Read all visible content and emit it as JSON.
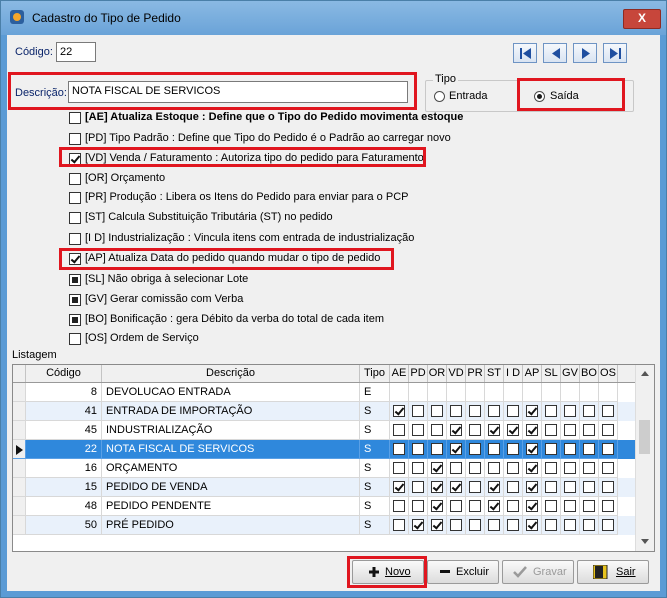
{
  "window": {
    "title": "Cadastro do Tipo de Pedido",
    "close_label": "X"
  },
  "codigo": {
    "label": "Código:",
    "value": "22"
  },
  "nav": {
    "icons": [
      "first-record-icon",
      "prev-record-icon",
      "next-record-icon",
      "last-record-icon"
    ]
  },
  "descricao": {
    "label": "Descrição:",
    "value": "NOTA FISCAL DE SERVICOS"
  },
  "tipo": {
    "group_label": "Tipo",
    "entrada": "Entrada",
    "saida": "Saída",
    "selected": "Saída"
  },
  "options": [
    {
      "key": "AE",
      "text": "[AE] Atualiza Estoque :  Define que o Tipo do Pedido movimenta estoque",
      "checked": false,
      "bold": true
    },
    {
      "key": "PD",
      "text": "[PD] Tipo Padrão :  Define que Tipo do Pedido é o Padrão ao carregar novo",
      "checked": false
    },
    {
      "key": "VD",
      "text": "[VD] Venda / Faturamento :  Autoriza tipo do pedido para Faturamento",
      "checked": true
    },
    {
      "key": "OR",
      "text": "[OR] Orçamento",
      "checked": false
    },
    {
      "key": "PR",
      "text": "[PR] Produção :  Libera os Itens do Pedido para enviar para o PCP",
      "checked": false
    },
    {
      "key": "ST",
      "text": "[ST] Calcula Substituição Tributária (ST) no pedido",
      "checked": false
    },
    {
      "key": "ID",
      "text": "[I D] Industrialização : Vincula itens com entrada de industrialização",
      "checked": false
    },
    {
      "key": "AP",
      "text": "[AP] Atualiza Data do pedido quando mudar o tipo de pedido",
      "checked": true
    },
    {
      "key": "SL",
      "text": "[SL] Não obriga à selecionar Lote",
      "checked": false,
      "grey": true
    },
    {
      "key": "GV",
      "text": "[GV] Gerar comissão com Verba",
      "checked": false,
      "grey": true
    },
    {
      "key": "BO",
      "text": "[BO] Bonificação : gera Débito da verba do total de cada item",
      "checked": false,
      "grey": true
    },
    {
      "key": "OS",
      "text": "[OS] Ordem de Serviço",
      "checked": false
    }
  ],
  "listagem": {
    "label": "Listagem",
    "headers": [
      "Código",
      "Descrição",
      "Tipo",
      "AE",
      "PD",
      "OR",
      "VD",
      "PR",
      "ST",
      "I D",
      "AP",
      "SL",
      "GV",
      "BO",
      "OS"
    ],
    "rows": [
      {
        "codigo": "8",
        "descricao": "DEVOLUCAO ENTRADA",
        "tipo": "E",
        "flags": null
      },
      {
        "codigo": "41",
        "descricao": "ENTRADA DE IMPORTAÇÃO",
        "tipo": "S",
        "flags": [
          1,
          0,
          0,
          0,
          0,
          0,
          0,
          1,
          0,
          0,
          0,
          0
        ]
      },
      {
        "codigo": "45",
        "descricao": "INDUSTRIALIZAÇÃO",
        "tipo": "S",
        "flags": [
          0,
          0,
          0,
          1,
          0,
          1,
          1,
          1,
          0,
          0,
          0,
          0
        ]
      },
      {
        "codigo": "22",
        "descricao": "NOTA FISCAL DE SERVICOS",
        "tipo": "S",
        "flags": [
          0,
          0,
          0,
          1,
          0,
          0,
          0,
          1,
          0,
          0,
          0,
          0
        ],
        "selected": true
      },
      {
        "codigo": "16",
        "descricao": "ORÇAMENTO",
        "tipo": "S",
        "flags": [
          0,
          0,
          1,
          0,
          0,
          0,
          0,
          1,
          0,
          0,
          0,
          0
        ]
      },
      {
        "codigo": "15",
        "descricao": "PEDIDO DE VENDA",
        "tipo": "S",
        "flags": [
          1,
          0,
          1,
          1,
          0,
          1,
          0,
          1,
          0,
          0,
          0,
          0
        ]
      },
      {
        "codigo": "48",
        "descricao": "PEDIDO PENDENTE",
        "tipo": "S",
        "flags": [
          0,
          0,
          1,
          0,
          0,
          1,
          0,
          1,
          0,
          0,
          0,
          0
        ]
      },
      {
        "codigo": "50",
        "descricao": "PRÉ PEDIDO",
        "tipo": "S",
        "flags": [
          0,
          1,
          1,
          0,
          0,
          0,
          0,
          1,
          0,
          0,
          0,
          0
        ]
      }
    ]
  },
  "buttons": {
    "novo": "Novo",
    "excluir": "Excluir",
    "gravar": "Gravar",
    "sair": "Sair"
  },
  "colors": {
    "highlight": "#e0161f",
    "selected_row": "#2f88dc",
    "alt_row": "#e9f1fb"
  }
}
